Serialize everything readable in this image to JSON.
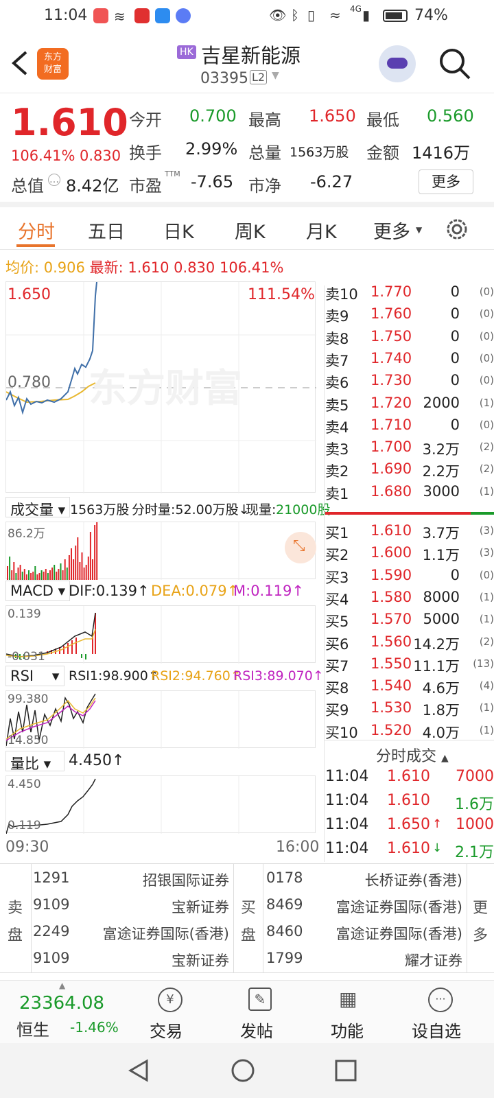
{
  "status_bar": {
    "time": "11:04",
    "battery": "74%",
    "network": "4G"
  },
  "header": {
    "market_badge": "HK",
    "title": "吉星新能源",
    "code": "03395",
    "level": "L2"
  },
  "quote": {
    "price": "1.610",
    "change_pct": "106.41%",
    "change": "0.830",
    "open_label": "今开",
    "open": "0.700",
    "high_label": "最高",
    "high": "1.650",
    "low_label": "最低",
    "low": "0.560",
    "turnover_label": "换手",
    "turnover": "2.99%",
    "volume_label": "总量",
    "volume": "1563万股",
    "amount_label": "金额",
    "amount": "1416万",
    "mktcap_label": "总值",
    "mktcap": "8.42亿",
    "pe_label": "市盈",
    "pe_sup": "TTM",
    "pe": "-7.65",
    "pb_label": "市净",
    "pb": "-6.27",
    "more_button": "更多"
  },
  "tabs": [
    "分时",
    "五日",
    "日K",
    "周K",
    "月K",
    "更多"
  ],
  "chart_info": {
    "avg_label": "均价:",
    "avg": "0.906",
    "latest_label": "最新:",
    "latest": "1.610",
    "change": "0.830",
    "pct": "106.41%"
  },
  "price_chart": {
    "top_price": "1.650",
    "top_pct": "111.54%",
    "prev_close": "0.780",
    "watermark": "东方财富"
  },
  "volume_panel": {
    "selector": "成交量",
    "total": "1563万股",
    "minute_vol": "分时量:52.00万股↓",
    "current_label": "现量:",
    "current": "21000股",
    "max": "86.2万"
  },
  "macd_panel": {
    "selector": "MACD",
    "dif": "DIF:0.139↑",
    "dea": "DEA:0.079↑",
    "m": "M:0.119↑",
    "top": "0.139",
    "bottom": "-0.031"
  },
  "rsi_panel": {
    "selector": "RSI",
    "rsi1": "RSI1:98.900↑",
    "rsi2": "RSI2:94.760↑",
    "rsi3": "RSI3:89.070↑",
    "top": "99.380",
    "bottom": "14.850"
  },
  "ratio_panel": {
    "selector": "量比",
    "value": "4.450↑",
    "top": "4.450",
    "bottom": "0.119"
  },
  "time_axis": {
    "start": "09:30",
    "end": "16:00"
  },
  "order_book": {
    "asks": [
      {
        "label": "卖10",
        "price": "1.770",
        "vol": "0",
        "cnt": "(0)"
      },
      {
        "label": "卖9",
        "price": "1.760",
        "vol": "0",
        "cnt": "(0)"
      },
      {
        "label": "卖8",
        "price": "1.750",
        "vol": "0",
        "cnt": "(0)"
      },
      {
        "label": "卖7",
        "price": "1.740",
        "vol": "0",
        "cnt": "(0)"
      },
      {
        "label": "卖6",
        "price": "1.730",
        "vol": "0",
        "cnt": "(0)"
      },
      {
        "label": "卖5",
        "price": "1.720",
        "vol": "2000",
        "cnt": "(1)"
      },
      {
        "label": "卖4",
        "price": "1.710",
        "vol": "0",
        "cnt": "(0)"
      },
      {
        "label": "卖3",
        "price": "1.700",
        "vol": "3.2万",
        "cnt": "(2)"
      },
      {
        "label": "卖2",
        "price": "1.690",
        "vol": "2.2万",
        "cnt": "(2)"
      },
      {
        "label": "卖1",
        "price": "1.680",
        "vol": "3000",
        "cnt": "(1)"
      }
    ],
    "bids": [
      {
        "label": "买1",
        "price": "1.610",
        "vol": "3.7万",
        "cnt": "(3)"
      },
      {
        "label": "买2",
        "price": "1.600",
        "vol": "1.1万",
        "cnt": "(3)"
      },
      {
        "label": "买3",
        "price": "1.590",
        "vol": "0",
        "cnt": "(0)"
      },
      {
        "label": "买4",
        "price": "1.580",
        "vol": "8000",
        "cnt": "(1)"
      },
      {
        "label": "买5",
        "price": "1.570",
        "vol": "5000",
        "cnt": "(1)"
      },
      {
        "label": "买6",
        "price": "1.560",
        "vol": "14.2万",
        "cnt": "(2)"
      },
      {
        "label": "买7",
        "price": "1.550",
        "vol": "11.1万",
        "cnt": "(13)"
      },
      {
        "label": "买8",
        "price": "1.540",
        "vol": "4.6万",
        "cnt": "(4)"
      },
      {
        "label": "买9",
        "price": "1.530",
        "vol": "1.8万",
        "cnt": "(1)"
      },
      {
        "label": "买10",
        "price": "1.520",
        "vol": "4.0万",
        "cnt": "(1)"
      }
    ]
  },
  "trades": {
    "title": "分时成交",
    "rows": [
      {
        "time": "11:04",
        "price": "1.610",
        "vol": "7000",
        "dir": ""
      },
      {
        "time": "11:04",
        "price": "1.610",
        "vol": "1.6万",
        "dir": ""
      },
      {
        "time": "11:04",
        "price": "1.650",
        "vol": "1000",
        "dir": "↑"
      },
      {
        "time": "11:04",
        "price": "1.610",
        "vol": "2.1万",
        "dir": "↓"
      }
    ]
  },
  "brokers": {
    "sell_label_1": "卖",
    "sell_label_2": "盘",
    "buy_label_1": "买",
    "buy_label_2": "盘",
    "more_1": "更",
    "more_2": "多",
    "sell": [
      {
        "id": "1291",
        "name": "招银国际证券"
      },
      {
        "id": "9109",
        "name": "宝新证券"
      },
      {
        "id": "2249",
        "name": "富途证券国际(香港)"
      },
      {
        "id": "9109",
        "name": "宝新证券"
      }
    ],
    "buy": [
      {
        "id": "0178",
        "name": "长桥证券(香港)"
      },
      {
        "id": "8469",
        "name": "富途证券国际(香港)"
      },
      {
        "id": "8460",
        "name": "富途证券国际(香港)"
      },
      {
        "id": "1799",
        "name": "耀才证券"
      }
    ]
  },
  "bottom_nav": {
    "index_value": "23364.08",
    "index_name": "恒生",
    "index_pct": "-1.46%",
    "trade": "交易",
    "post": "发帖",
    "functions": "功能",
    "add_watch": "设自选"
  },
  "colors": {
    "up": "#e0262a",
    "down": "#1a9a2a",
    "accent": "#e8742c",
    "avg_line": "#e8b830"
  }
}
